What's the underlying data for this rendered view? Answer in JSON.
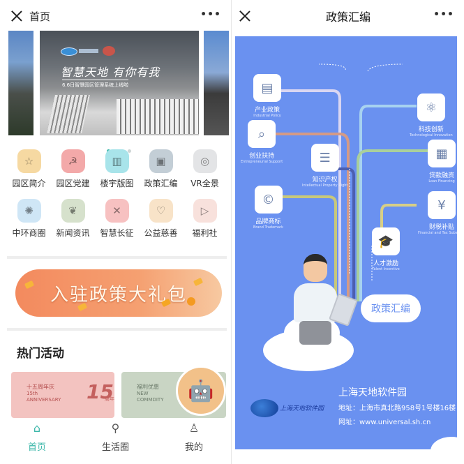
{
  "left": {
    "title": "首页",
    "more": "•••",
    "banner": {
      "headline": "智慧天地  有你有我",
      "subtitle": "6.6日智慧园区管理系统上线啦",
      "slide_count": 4,
      "active_slide": 1
    },
    "grid": [
      {
        "label": "园区简介",
        "icon": "certificate-icon",
        "glyph": "☆",
        "color": "#f6d9a2"
      },
      {
        "label": "园区党建",
        "icon": "party-emblem-icon",
        "glyph": "☭",
        "color": "#f3a9a9"
      },
      {
        "label": "楼宇版图",
        "icon": "map-icon",
        "glyph": "▥",
        "color": "#a8e4ea"
      },
      {
        "label": "政策汇编",
        "icon": "briefcase-icon",
        "glyph": "▣",
        "color": "#c3ced6"
      },
      {
        "label": "VR全景",
        "icon": "vr-icon",
        "glyph": "◎",
        "color": "#e3e4e6"
      },
      {
        "label": "中环商圈",
        "icon": "lightbulb-icon",
        "glyph": "✺",
        "color": "#cfe6f6"
      },
      {
        "label": "新闻资讯",
        "icon": "leaf-icon",
        "glyph": "❦",
        "color": "#d6e1cc"
      },
      {
        "label": "智慧长征",
        "icon": "route-icon",
        "glyph": "✕",
        "color": "#f7c1c1"
      },
      {
        "label": "公益慈善",
        "icon": "heart-handshake-icon",
        "glyph": "♡",
        "color": "#f8e3c8"
      },
      {
        "label": "福利社",
        "icon": "play-icon",
        "glyph": "▷",
        "color": "#f8e1dc"
      }
    ],
    "promo": "入驻政策大礼包",
    "hot_title": "热门活动",
    "cards": [
      {
        "cn": "十五周年庆",
        "en1": "15th",
        "en2": "ANNIVERSARY",
        "badge": "15",
        "badge_suffix": "周年"
      },
      {
        "cn": "福利优惠",
        "en1": "NEW",
        "en2": "COMMDITY"
      }
    ],
    "tabs": [
      {
        "label": "首页",
        "icon": "home-icon",
        "glyph": "⌂",
        "active": true
      },
      {
        "label": "生活圈",
        "icon": "map-pin-icon",
        "glyph": "⚲",
        "active": false
      },
      {
        "label": "我的",
        "icon": "user-icon",
        "glyph": "♙",
        "active": false
      }
    ],
    "accent": "#3bb7a9"
  },
  "right": {
    "title": "政策汇编",
    "more": "•••",
    "nodes": [
      {
        "cn": "产业政策",
        "en": "Industrial Policy",
        "icon": "certificate-icon",
        "glyph": "▤"
      },
      {
        "cn": "创业扶持",
        "en": "Entrepreneurial Support",
        "icon": "search-document-icon",
        "glyph": "⌕"
      },
      {
        "cn": "知识产权",
        "en": "Intellectual Property Right",
        "icon": "layers-icon",
        "glyph": "☰"
      },
      {
        "cn": "品牌商标",
        "en": "Brand Trademark",
        "icon": "copyright-icon",
        "glyph": "©"
      },
      {
        "cn": "科技创新",
        "en": "Technological Innovation",
        "icon": "atom-icon",
        "glyph": "⚛"
      },
      {
        "cn": "贷款融资",
        "en": "Loan Financing",
        "icon": "chart-icon",
        "glyph": "▦"
      },
      {
        "cn": "财税补贴",
        "en": "Financial and Tax Subsidies",
        "icon": "yen-icon",
        "glyph": "¥"
      },
      {
        "cn": "人才激励",
        "en": "Talent Incentive",
        "icon": "graduation-cap-icon",
        "glyph": "🎓"
      }
    ],
    "cloud_label": "政策汇编",
    "company": "上海天地软件园",
    "address": "地址：上海市真北路958号1号楼16楼",
    "website": "网址：www.universal.sh.cn",
    "logo_text": "上海天地软件园",
    "poster_color": "#6a91f0"
  }
}
